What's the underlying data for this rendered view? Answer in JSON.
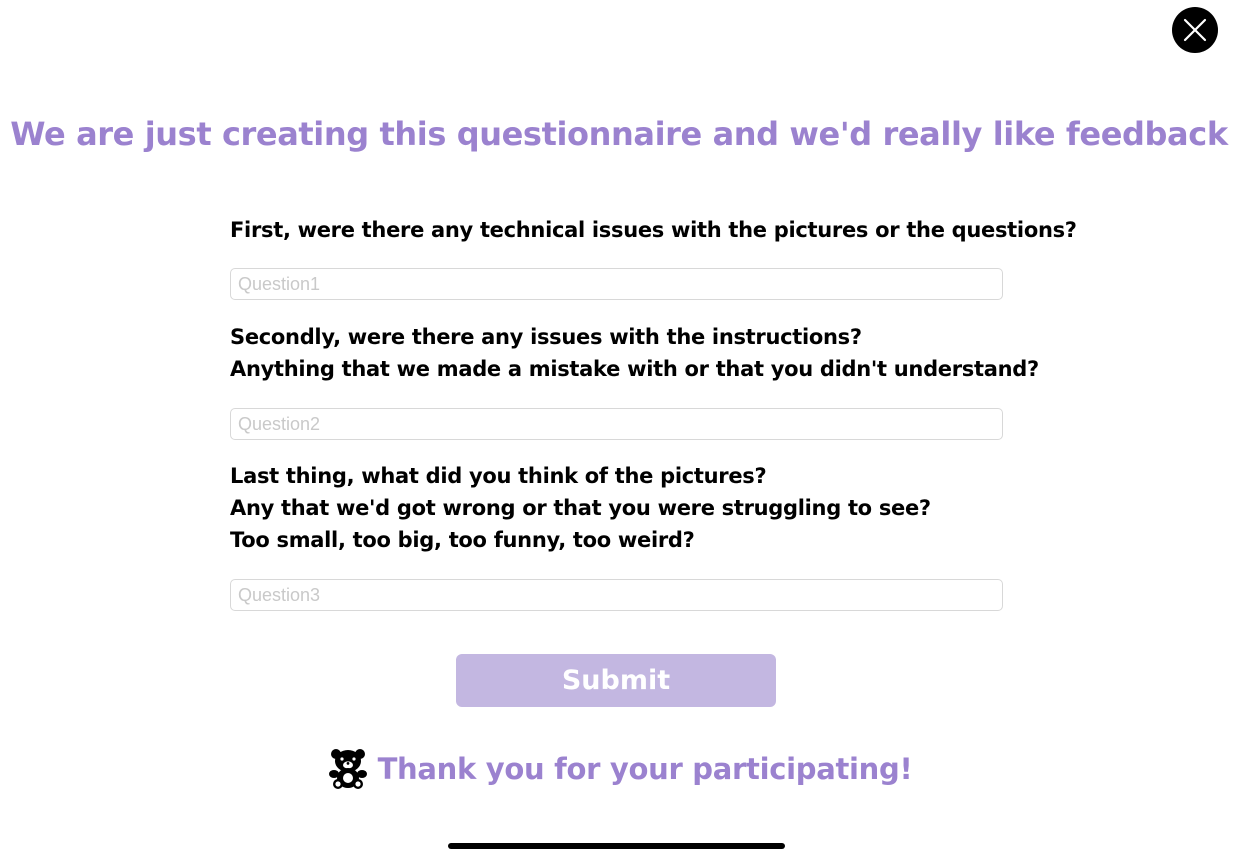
{
  "colors": {
    "accent": "#9b82cf",
    "submit_bg": "#c3b7e1",
    "text": "#000000"
  },
  "header": {
    "close_icon": "close-icon"
  },
  "title": "We are just creating this questionnaire and we'd really like feedback",
  "questions": [
    {
      "lines": [
        "First, were there any technical issues with the pictures or the questions?"
      ],
      "value": "",
      "placeholder": "Question1"
    },
    {
      "lines": [
        "Secondly, were there any issues with the instructions?",
        "Anything that we made a mistake with or that you didn't understand?"
      ],
      "value": "",
      "placeholder": "Question2"
    },
    {
      "lines": [
        "Last thing, what did you think of the pictures?",
        "Any that we'd got wrong or that you were struggling to see?",
        "Too small, too big, too funny, too weird?"
      ],
      "value": "",
      "placeholder": "Question3"
    }
  ],
  "submit_label": "Submit",
  "footer": {
    "icon": "teddy-bear-icon",
    "thanks": "Thank you for your participating!"
  }
}
